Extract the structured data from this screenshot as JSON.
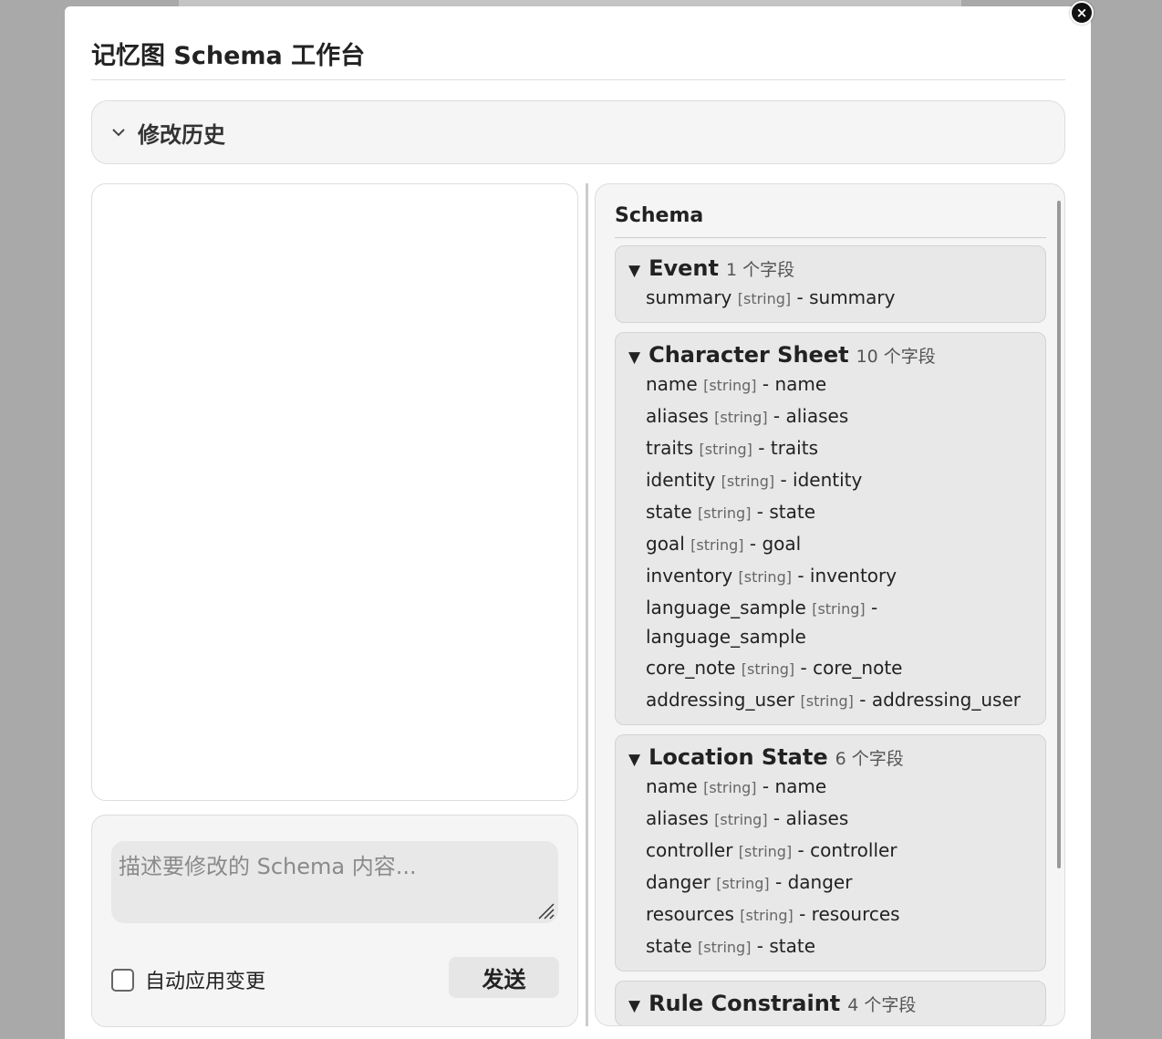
{
  "title": "记忆图 Schema 工作台",
  "close_glyph": "×",
  "history": {
    "label": "修改历史"
  },
  "input": {
    "placeholder": "描述要修改的 Schema 内容...",
    "value": ""
  },
  "auto_apply_label": "自动应用变更",
  "send_label": "发送",
  "schema": {
    "heading": "Schema",
    "entities": [
      {
        "name": "Event",
        "count": "1 个字段",
        "fields": [
          {
            "name": "summary",
            "type": "[string]",
            "desc": "summary"
          }
        ]
      },
      {
        "name": "Character Sheet",
        "count": "10 个字段",
        "fields": [
          {
            "name": "name",
            "type": "[string]",
            "desc": "name"
          },
          {
            "name": "aliases",
            "type": "[string]",
            "desc": "aliases"
          },
          {
            "name": "traits",
            "type": "[string]",
            "desc": "traits"
          },
          {
            "name": "identity",
            "type": "[string]",
            "desc": "identity"
          },
          {
            "name": "state",
            "type": "[string]",
            "desc": "state"
          },
          {
            "name": "goal",
            "type": "[string]",
            "desc": "goal"
          },
          {
            "name": "inventory",
            "type": "[string]",
            "desc": "inventory"
          },
          {
            "name": "language_sample",
            "type": "[string]",
            "desc": "language_sample"
          },
          {
            "name": "core_note",
            "type": "[string]",
            "desc": "core_note"
          },
          {
            "name": "addressing_user",
            "type": "[string]",
            "desc": "addressing_user"
          }
        ]
      },
      {
        "name": "Location State",
        "count": "6 个字段",
        "fields": [
          {
            "name": "name",
            "type": "[string]",
            "desc": "name"
          },
          {
            "name": "aliases",
            "type": "[string]",
            "desc": "aliases"
          },
          {
            "name": "controller",
            "type": "[string]",
            "desc": "controller"
          },
          {
            "name": "danger",
            "type": "[string]",
            "desc": "danger"
          },
          {
            "name": "resources",
            "type": "[string]",
            "desc": "resources"
          },
          {
            "name": "state",
            "type": "[string]",
            "desc": "state"
          }
        ]
      },
      {
        "name": "Rule Constraint",
        "count": "4 个字段",
        "fields": []
      }
    ]
  }
}
